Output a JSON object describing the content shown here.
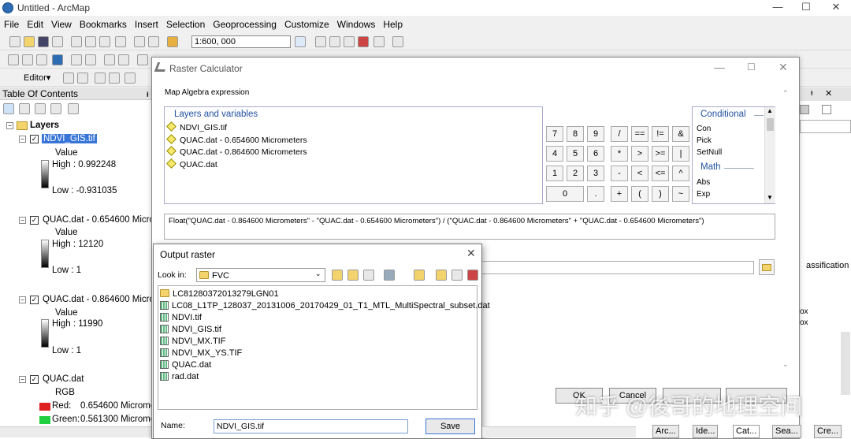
{
  "app": {
    "title": "Untitled - ArcMap"
  },
  "window_controls": {
    "minimize": "—",
    "maximize": "☐",
    "close": "✕"
  },
  "menu": [
    "File",
    "Edit",
    "View",
    "Bookmarks",
    "Insert",
    "Selection",
    "Geoprocessing",
    "Customize",
    "Windows",
    "Help"
  ],
  "toolbar": {
    "scale": "1:600, 000",
    "editor_label": "Editor▾"
  },
  "toc": {
    "title": "Table Of Contents",
    "pin": "ᵻ",
    "layers_label": "Layers",
    "items": [
      {
        "name": "NDVI_GIS.tif",
        "value_label": "Value",
        "high": "High : 0.992248",
        "low": "Low : -0.931035"
      },
      {
        "name": "QUAC.dat - 0.654600 Micro",
        "value_label": "Value",
        "high": "High : 12120",
        "low": "Low : 1"
      },
      {
        "name": "QUAC.dat - 0.864600 Micro",
        "value_label": "Value",
        "high": "High : 11990",
        "low": "Low : 1"
      },
      {
        "name": "QUAC.dat",
        "value_label": "RGB",
        "red": "Red:",
        "red_value": "0.654600 Microme",
        "green": "Green:",
        "green_value": "0.561300 Microme"
      }
    ]
  },
  "raster_calculator": {
    "title": "Raster Calculator",
    "expr_label": "Map Algebra expression",
    "layers_title": "Layers and variables",
    "layers": [
      "NDVI_GIS.tif",
      "QUAC.dat - 0.654600 Micrometers",
      "QUAC.dat - 0.864600 Micrometers",
      "QUAC.dat"
    ],
    "buttons": [
      [
        "7",
        "8",
        "9",
        "/",
        "==",
        "!=",
        "&"
      ],
      [
        "4",
        "5",
        "6",
        "*",
        ">",
        ">=",
        "|"
      ],
      [
        "1",
        "2",
        "3",
        "-",
        "<",
        "<=",
        "^"
      ],
      [
        "0",
        ".",
        "+",
        "(",
        ")",
        "~"
      ]
    ],
    "conditional_title": "Conditional",
    "conditional_items": [
      "Con",
      "Pick",
      "SetNull"
    ],
    "math_title": "Math",
    "math_items": [
      "Abs",
      "Exp"
    ],
    "expression": "Float(\"QUAC.dat - 0.864600 Micrometers\" - \"QUAC.dat - 0.654600 Micrometers\") / (\"QUAC.dat - 0.864600 Micrometers\" + \"QUAC.dat - 0.654600 Micrometers\")",
    "ok_label": "OK",
    "cancel_label": "Cancel"
  },
  "output_raster": {
    "title": "Output raster",
    "look_in_label": "Look in:",
    "look_in_value": "FVC",
    "files": [
      {
        "name": "LC81280372013279LGN01",
        "type": "folder"
      },
      {
        "name": "LC08_L1TP_128037_20131006_20170429_01_T1_MTL_MultiSpectral_subset.dat",
        "type": "raster"
      },
      {
        "name": "NDVI.tif",
        "type": "raster"
      },
      {
        "name": "NDVI_GIS.tif",
        "type": "raster"
      },
      {
        "name": "NDVI_MX.TIF",
        "type": "raster"
      },
      {
        "name": "NDVI_MX_YS.TIF",
        "type": "raster"
      },
      {
        "name": "QUAC.dat",
        "type": "raster"
      },
      {
        "name": "rad.dat",
        "type": "raster"
      }
    ],
    "name_label": "Name:",
    "name_value": "NDVI_GIS.tif",
    "save_label": "Save"
  },
  "right_panel": {
    "partial_text_1": "assification",
    "partial_text_2": "ox",
    "partial_text_3": "ox"
  },
  "taskbar": [
    "Arc...",
    "Ide...",
    "Cat...",
    "Sea...",
    "Cre..."
  ],
  "watermark": "知乎 @後哥的地理空间"
}
